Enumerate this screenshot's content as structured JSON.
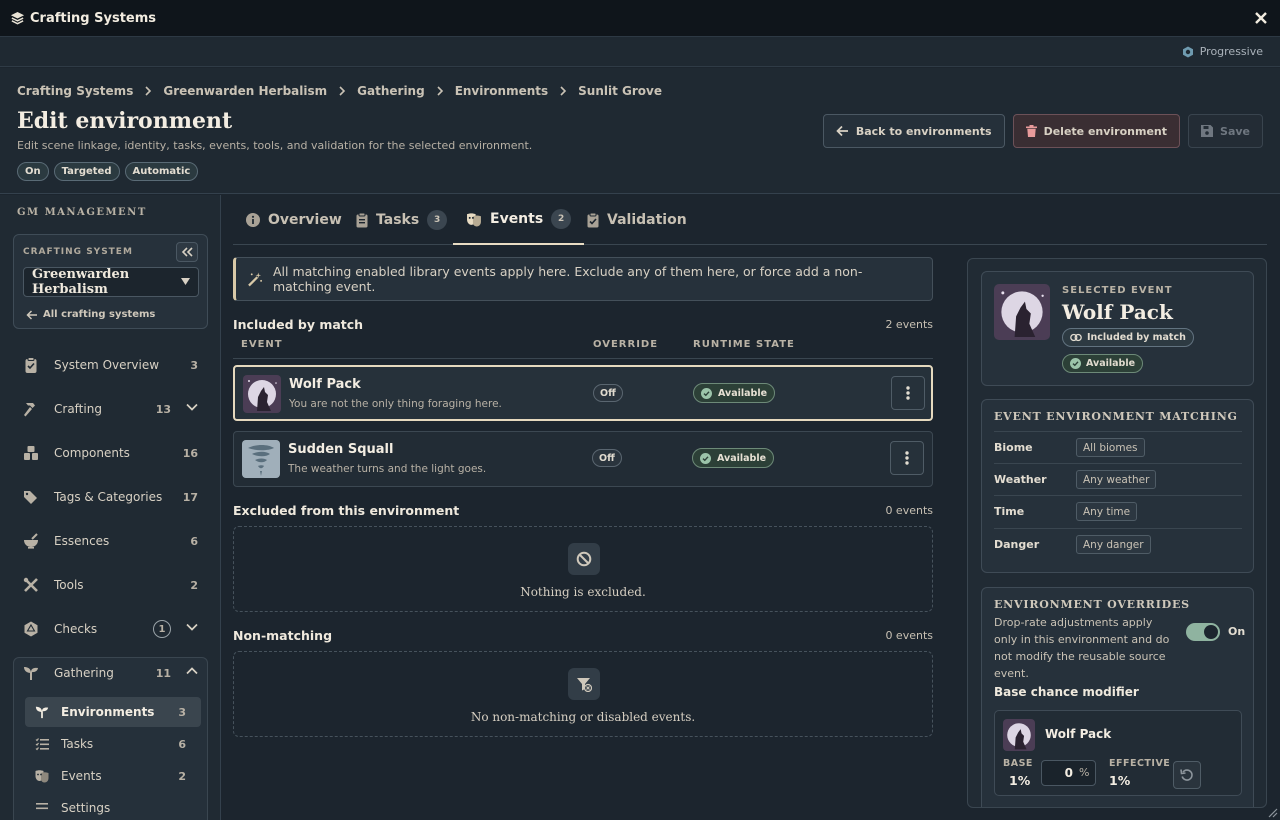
{
  "window": {
    "title": "Crafting Systems"
  },
  "subbar": {
    "mode": "Progressive"
  },
  "breadcrumb": [
    "Crafting Systems",
    "Greenwarden Herbalism",
    "Gathering",
    "Environments",
    "Sunlit Grove"
  ],
  "header": {
    "title": "Edit environment",
    "subtitle": "Edit scene linkage, identity, tasks, events, tools, and validation for the selected environment.",
    "chips": [
      "On",
      "Targeted",
      "Automatic"
    ],
    "back_label": "Back to environments",
    "delete_label": "Delete environment",
    "save_label": "Save"
  },
  "sidebar": {
    "heading": "GM MANAGEMENT",
    "system_label": "CRAFTING SYSTEM",
    "system_value": "Greenwarden Herbalism",
    "all_systems": "All crafting systems",
    "items": [
      {
        "label": "System Overview",
        "count": "3"
      },
      {
        "label": "Crafting",
        "count": "13"
      },
      {
        "label": "Components",
        "count": "16"
      },
      {
        "label": "Tags & Categories",
        "count": "17"
      },
      {
        "label": "Essences",
        "count": "6"
      },
      {
        "label": "Tools",
        "count": "2"
      },
      {
        "label": "Checks",
        "count": "1"
      },
      {
        "label": "Gathering",
        "count": "11"
      }
    ],
    "subitems": [
      {
        "label": "Environments",
        "count": "3"
      },
      {
        "label": "Tasks",
        "count": "6"
      },
      {
        "label": "Events",
        "count": "2"
      },
      {
        "label": "Settings",
        "count": ""
      }
    ]
  },
  "tabs": [
    {
      "label": "Overview",
      "badge": ""
    },
    {
      "label": "Tasks",
      "badge": "3"
    },
    {
      "label": "Events",
      "badge": "2"
    },
    {
      "label": "Validation",
      "badge": ""
    }
  ],
  "notice": "All matching enabled library events apply here. Exclude any of them here, or force add a non-matching event.",
  "included": {
    "title": "Included by match",
    "count": "2 events",
    "columns": [
      "EVENT",
      "OVERRIDE",
      "RUNTIME STATE"
    ],
    "rows": [
      {
        "name": "Wolf Pack",
        "desc": "You are not the only thing foraging here.",
        "override": "Off",
        "state": "Available"
      },
      {
        "name": "Sudden Squall",
        "desc": "The weather turns and the light goes.",
        "override": "Off",
        "state": "Available"
      }
    ]
  },
  "excluded": {
    "title": "Excluded from this environment",
    "count": "0 events",
    "empty": "Nothing is excluded."
  },
  "nonmatching": {
    "title": "Non-matching",
    "count": "0 events",
    "empty": "No non-matching or disabled events."
  },
  "panel": {
    "selected_label": "SELECTED EVENT",
    "selected_name": "Wolf Pack",
    "pill_match": "Included by match",
    "pill_available": "Available",
    "matching_title": "EVENT ENVIRONMENT MATCHING",
    "matching": [
      {
        "k": "Biome",
        "v": "All biomes"
      },
      {
        "k": "Weather",
        "v": "Any weather"
      },
      {
        "k": "Time",
        "v": "Any time"
      },
      {
        "k": "Danger",
        "v": "Any danger"
      }
    ],
    "overrides_title": "ENVIRONMENT OVERRIDES",
    "overrides_desc": "Drop-rate adjustments apply only in this environment and do not modify the reusable source event.",
    "toggle_label": "On",
    "bcm_title": "Base chance modifier",
    "mod_name": "Wolf Pack",
    "base_label": "BASE",
    "base_value": "1%",
    "input_value": "0",
    "pct": "%",
    "effective_label": "EFFECTIVE",
    "effective_value": "1%"
  },
  "colors": {
    "accent": "#e5d9be",
    "available": "#2c4037",
    "danger": "#3a2e33"
  }
}
